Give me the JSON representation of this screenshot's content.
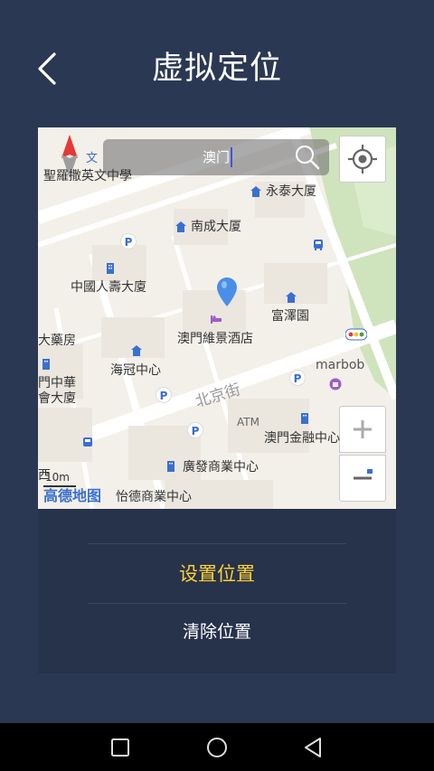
{
  "header": {
    "title": "虚拟定位"
  },
  "map": {
    "search_value": "澳门",
    "scale_label": "10m",
    "logo_text": "高德地图",
    "labels": {
      "school": "聖羅撒英文中學",
      "wing_tai": "永泰大厦",
      "nam_seng": "南成大厦",
      "china_life": "中國人壽大廈",
      "fu_chak": "富澤園",
      "hotel": "澳門維景酒店",
      "pharmacy": "大藥房",
      "hoi_kun": "海冠中心",
      "school2": "門中華",
      "school3": "會大廈",
      "beijing_street": "北京街",
      "marbob": "marbob",
      "atm": "ATM",
      "finance": "澳門金融中心",
      "kwong_fat": "廣發商業中心",
      "yi_tak": "怡德商業中心",
      "school_prefix": "西"
    }
  },
  "panel": {
    "set_location": "设置位置",
    "clear_location": "清除位置"
  },
  "colors": {
    "background": "#2b3853",
    "panel": "#27324b",
    "accent_yellow": "#ffd230",
    "map_blue": "#3a6fd0"
  }
}
